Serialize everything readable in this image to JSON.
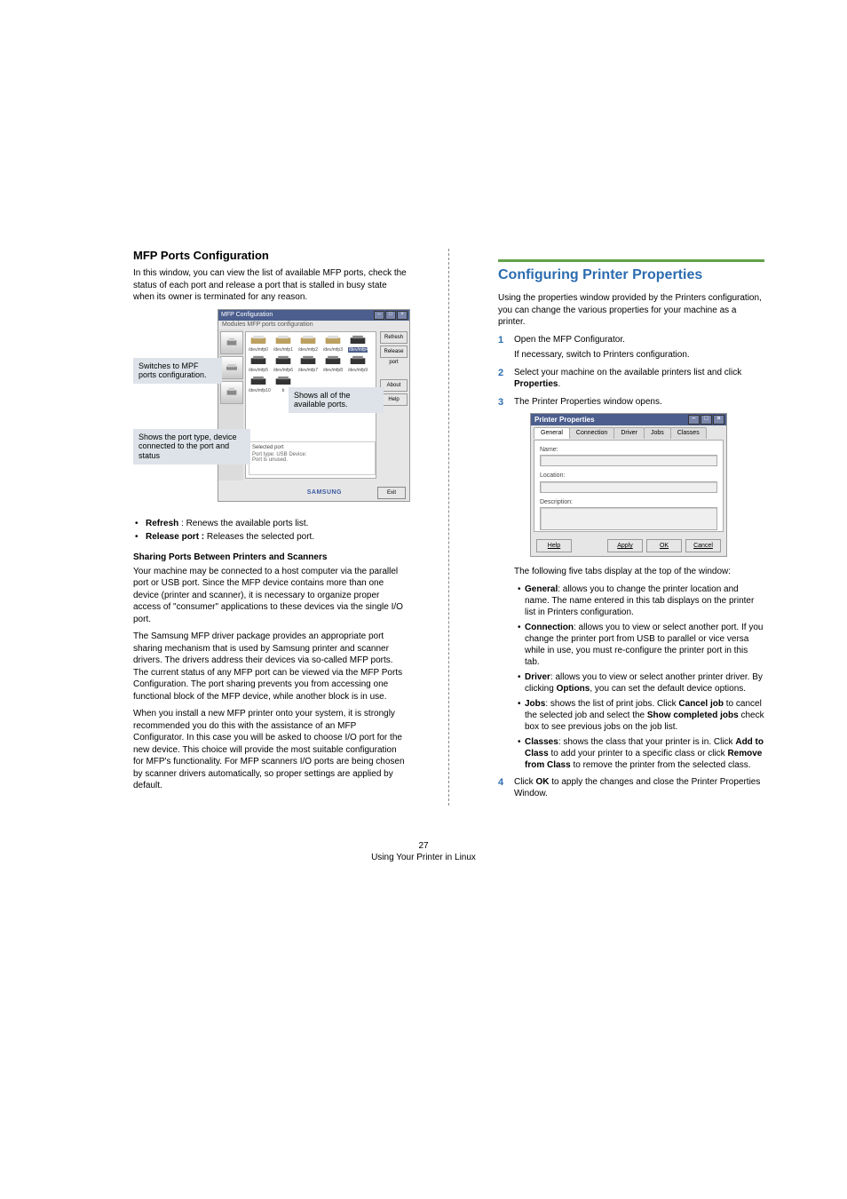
{
  "left": {
    "h2": "MFP Ports Configuration",
    "intro": "In this window, you can view the list of available MFP ports, check the status of each port and release a port that is stalled in busy state when its owner is terminated for any reason.",
    "fig1": {
      "title": "MFP Configuration",
      "menubar": "Modules    MFP ports configuration",
      "side_tooltip": "",
      "ports": [
        "/dev/mfp0",
        "/dev/mfp1",
        "/dev/mfp2",
        "/dev/mfp3",
        "/dev/mfp4",
        "/dev/mfp5",
        "/dev/mfp6",
        "/dev/mfp7",
        "/dev/mfp8",
        "/dev/mfp9",
        "/dev/mfp10",
        "b"
      ],
      "selected_index": 4,
      "rbuttons": [
        "Refresh",
        "Release port",
        "About",
        "Help"
      ],
      "selport_title": "Selected port",
      "selport_line1": "Port type: USB   Device:",
      "selport_line2": "Port is unused.",
      "logo": "SAMSUNG",
      "exit": "Exit",
      "callout1": "Switches to MPF ports configuration.",
      "callout2": "Shows the port type, device connected to the port and status",
      "callout3": "Shows all of the available ports."
    },
    "bullets": [
      {
        "term": "Refresh",
        "text": " : Renews the available ports list."
      },
      {
        "term": "Release port :",
        "text": " Releases the selected port."
      }
    ],
    "sharing_h": "Sharing Ports Between Printers and Scanners",
    "sharing_p1": "Your machine may be connected to a host computer via the parallel port or USB port. Since the MFP device contains more than one device (printer and scanner), it is necessary to organize proper access of \"consumer\" applications to these devices via the single I/O port.",
    "sharing_p2": "The Samsung MFP driver package provides an appropriate port sharing mechanism that is used by Samsung printer and scanner drivers. The drivers address their devices via so-called MFP ports. The current status of any MFP port can be viewed via the MFP Ports Configuration. The port sharing prevents you from accessing one functional block of the MFP device, while another block is in use.",
    "sharing_p3": "When you install a new MFP printer onto your system, it is strongly recommended you do this with the assistance of an MFP Configurator. In this case you will be asked to choose I/O port for the new device. This choice will provide the most suitable configuration for MFP's functionality. For MFP scanners I/O ports are being chosen by scanner drivers automatically, so proper settings are applied by default."
  },
  "right": {
    "h1": "Configuring Printer Properties",
    "intro": "Using the properties window provided by the Printers configuration, you can change the various properties for your machine as a printer.",
    "steps": {
      "s1": "Open the MFP Configurator.",
      "s1_note": "If necessary, switch to Printers configuration.",
      "s2_a": "Select your machine on the available printers list and click ",
      "s2_b": "Properties",
      "s2_c": ".",
      "s3": "The Printer Properties window opens.",
      "s4_a": "Click ",
      "s4_b": "OK",
      "s4_c": " to apply the changes and close the Printer Properties Window."
    },
    "fig2": {
      "title": "Printer Properties",
      "tabs": [
        "General",
        "Connection",
        "Driver",
        "Jobs",
        "Classes"
      ],
      "fields": [
        "Name:",
        "Location:",
        "Description:"
      ],
      "buttons_left": [
        "Help"
      ],
      "buttons_right": [
        "Apply",
        "OK",
        "Cancel"
      ]
    },
    "tabs_intro": "The following five tabs display at the top of the window:",
    "tab_bullets": [
      {
        "b": "General",
        "t": ": allows you to change the printer location and name. The name entered in this tab displays on the printer list in Printers configuration."
      },
      {
        "b": "Connection",
        "t": ": allows you to view or select another port. If you change the printer port from USB to parallel or vice versa while in use, you must re-configure the printer port in this tab."
      },
      {
        "b": "Driver",
        "t": ": allows you to view or select another printer driver. By clicking ",
        "b2": "Options",
        "t2": ", you can set the default device options."
      },
      {
        "b": "Jobs",
        "t": ": shows the list of print jobs. Click ",
        "b2": "Cancel job",
        "t2": " to cancel the selected job and select the ",
        "b3": "Show completed jobs",
        "t3": " check box to see previous jobs on the job list."
      },
      {
        "b": "Classes",
        "t": ": shows the class that your printer is in. Click ",
        "b2": "Add to Class",
        "t2": " to add your printer to a specific class or click ",
        "b3": "Remove from Class",
        "t3": " to remove the printer from the selected class."
      }
    ]
  },
  "footer": {
    "page": "27",
    "line": "Using Your Printer in Linux"
  }
}
